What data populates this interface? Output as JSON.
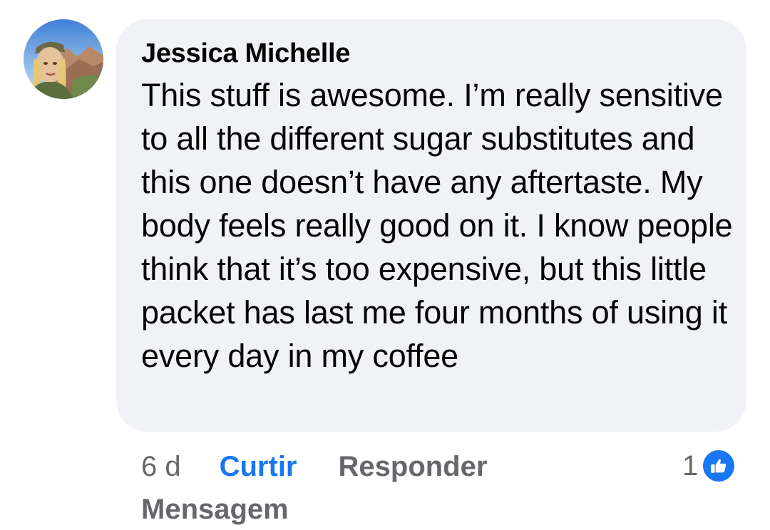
{
  "comment": {
    "author": "Jessica Michelle",
    "text": "This stuff is awesome. I’m really sensitive to all the different sugar substitutes and this one doesn’t have any aftertaste. My body feels really good on it. I know people think that it’s too expensive, but this little packet has last me four months of using it every day in my coffee"
  },
  "actions": {
    "time": "6 d",
    "like_label": "Curtir",
    "reply_label": "Responder",
    "message_label": "Mensagem"
  },
  "reactions": {
    "count": "1",
    "icon": "thumbs-up-icon"
  },
  "colors": {
    "bubble": "#f0f2f5",
    "accent": "#1877f2",
    "secondary_text": "#65676b"
  }
}
